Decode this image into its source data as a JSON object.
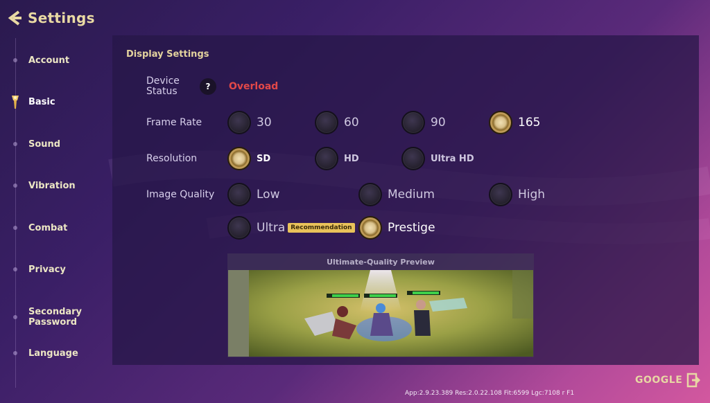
{
  "header": {
    "title": "Settings"
  },
  "sidebar": {
    "items": [
      {
        "label": "Account"
      },
      {
        "label": "Basic"
      },
      {
        "label": "Sound"
      },
      {
        "label": "Vibration"
      },
      {
        "label": "Combat"
      },
      {
        "label": "Privacy"
      },
      {
        "label": "Secondary Password"
      },
      {
        "label": "Language"
      }
    ]
  },
  "display": {
    "section_title": "Display Settings",
    "device_status": {
      "label": "Device Status",
      "help": "?",
      "value": "Overload"
    },
    "frame_rate": {
      "label": "Frame Rate",
      "options": [
        "30",
        "60",
        "90",
        "165"
      ],
      "selected": "165"
    },
    "resolution": {
      "label": "Resolution",
      "options": [
        "SD",
        "HD",
        "Ultra HD"
      ],
      "selected": "SD"
    },
    "image_quality": {
      "label": "Image Quality",
      "options": [
        "Low",
        "Medium",
        "High",
        "Ultra",
        "Prestige"
      ],
      "selected": "Prestige",
      "ultra_badge": "Recommendation"
    },
    "preview": {
      "title": "Ultimate-Quality Preview"
    }
  },
  "footer": {
    "version": "App:2.9.23.389 Res:2.0.22.108 Fit:6599 Lgc:7108 r F1",
    "account_label": "GOOGLE"
  },
  "colors": {
    "accent_gold": "#e4d39e",
    "status_red": "#e24848"
  }
}
